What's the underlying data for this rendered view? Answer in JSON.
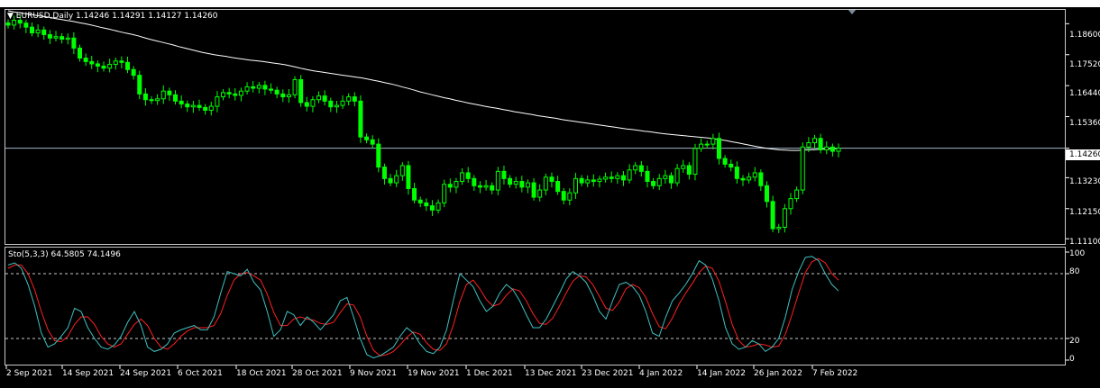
{
  "window": {
    "symbol_header": "EURUSD,Daily  1.14246 1.14291 1.14127 1.14260"
  },
  "indicator": {
    "label": "Sto(5,3,3) 64.5805 74.1496",
    "levels": [
      "100",
      "80",
      "20",
      "0"
    ]
  },
  "price_axis": {
    "labels": [
      "1.18600",
      "1.17520",
      "1.16440",
      "1.15360",
      "1.13230",
      "1.12150",
      "1.11100"
    ],
    "current_price": "1.14260"
  },
  "time_axis": {
    "labels": [
      "2 Sep 2021",
      "14 Sep 2021",
      "24 Sep 2021",
      "6 Oct 2021",
      "18 Oct 2021",
      "28 Oct 2021",
      "9 Nov 2021",
      "19 Nov 2021",
      "1 Dec 2021",
      "13 Dec 2021",
      "23 Dec 2021",
      "4 Jan 2022",
      "14 Jan 2022",
      "26 Jan 2022",
      "7 Feb 2022"
    ]
  },
  "colors": {
    "background": "#000000",
    "candle": "#00ff00",
    "moving_average": "#ffffff",
    "stoch_main": "#40c0c0",
    "stoch_signal": "#ff2020",
    "price_line": "#a0b4c8"
  },
  "chart_data": {
    "type": "line",
    "ylim": [
      1.1095,
      1.1905
    ],
    "candles_close": [
      1.1855,
      1.1872,
      1.1862,
      1.1848,
      1.1828,
      1.1838,
      1.1822,
      1.181,
      1.1815,
      1.1806,
      1.181,
      1.1775,
      1.174,
      1.1728,
      1.172,
      1.1712,
      1.1705,
      1.1718,
      1.173,
      1.1725,
      1.17,
      1.168,
      1.1615,
      1.1595,
      1.1592,
      1.1598,
      1.1625,
      1.1612,
      1.159,
      1.158,
      1.157,
      1.1575,
      1.1568,
      1.1558,
      1.1572,
      1.1605,
      1.162,
      1.1615,
      1.161,
      1.1625,
      1.164,
      1.1635,
      1.1645,
      1.1632,
      1.1628,
      1.1615,
      1.1605,
      1.1612,
      1.1665,
      1.1585,
      1.1572,
      1.1595,
      1.1608,
      1.159,
      1.157,
      1.1575,
      1.159,
      1.1605,
      1.159,
      1.1465,
      1.1455,
      1.144,
      1.136,
      1.132,
      1.1305,
      1.133,
      1.1365,
      1.1285,
      1.1245,
      1.1235,
      1.1225,
      1.121,
      1.1235,
      1.13,
      1.129,
      1.131,
      1.134,
      1.132,
      1.1295,
      1.129,
      1.1295,
      1.128,
      1.1345,
      1.132,
      1.13,
      1.131,
      1.129,
      1.1305,
      1.1255,
      1.128,
      1.1325,
      1.131,
      1.1275,
      1.1245,
      1.127,
      1.132,
      1.1305,
      1.1315,
      1.131,
      1.1318,
      1.1325,
      1.132,
      1.133,
      1.1315,
      1.135,
      1.1365,
      1.1345,
      1.131,
      1.1295,
      1.132,
      1.133,
      1.1305,
      1.1355,
      1.1365,
      1.1335,
      1.1425,
      1.144,
      1.144,
      1.146,
      1.139,
      1.137,
      1.136,
      1.132,
      1.1315,
      1.1325,
      1.134,
      1.1295,
      1.124,
      1.1145,
      1.115,
      1.1215,
      1.125,
      1.128,
      1.143,
      1.1445,
      1.146,
      1.142,
      1.143,
      1.1415,
      1.1426
    ],
    "ma": [
      1.1905,
      1.1901,
      1.1898,
      1.1895,
      1.1892,
      1.1888,
      1.1885,
      1.1882,
      1.1878,
      1.1875,
      1.1871,
      1.1868,
      1.1864,
      1.186,
      1.1856,
      1.1851,
      1.1846,
      1.1842,
      1.1837,
      1.1832,
      1.1827,
      1.1823,
      1.1818,
      1.1812,
      1.1806,
      1.1801,
      1.1796,
      1.1791,
      1.1786,
      1.178,
      1.1775,
      1.177,
      1.1765,
      1.176,
      1.1756,
      1.1752,
      1.1749,
      1.1746,
      1.1742,
      1.1739,
      1.1736,
      1.1733,
      1.1731,
      1.1729,
      1.1726,
      1.1723,
      1.172,
      1.1717,
      1.1713,
      1.1708,
      1.1703,
      1.1699,
      1.1695,
      1.1692,
      1.1689,
      1.1686,
      1.1683,
      1.168,
      1.1677,
      1.1674,
      1.1671,
      1.1667,
      1.1663,
      1.1659,
      1.1654,
      1.165,
      1.1645,
      1.1639,
      1.1634,
      1.1628,
      1.1622,
      1.1617,
      1.1612,
      1.1607,
      1.1602,
      1.1598,
      1.1593,
      1.1589,
      1.1584,
      1.158,
      1.1576,
      1.1572,
      1.1568,
      1.1565,
      1.1561,
      1.1557,
      1.1553,
      1.155,
      1.1546,
      1.1543,
      1.1539,
      1.1536,
      1.1533,
      1.153,
      1.1526,
      1.1523,
      1.152,
      1.1517,
      1.1514,
      1.1511,
      1.1508,
      1.1505,
      1.1502,
      1.1499,
      1.1496,
      1.1493,
      1.1491,
      1.1488,
      1.1485,
      1.1483,
      1.148,
      1.1477,
      1.1475,
      1.1473,
      1.1471,
      1.1469,
      1.1467,
      1.1465,
      1.1463,
      1.1461,
      1.1458,
      1.1455,
      1.1452,
      1.1448,
      1.1444,
      1.144,
      1.1436,
      1.1432,
      1.1428,
      1.1425,
      1.1422,
      1.142,
      1.1419,
      1.1418,
      1.1418,
      1.1419,
      1.142,
      1.1421,
      1.1422,
      1.1423,
      1.1424,
      1.1425
    ],
    "stoch_main": [
      88,
      90,
      85,
      70,
      50,
      25,
      12,
      15,
      22,
      30,
      48,
      45,
      30,
      20,
      12,
      10,
      14,
      22,
      35,
      45,
      32,
      12,
      8,
      10,
      15,
      25,
      28,
      30,
      32,
      28,
      28,
      40,
      62,
      82,
      80,
      78,
      84,
      72,
      65,
      45,
      22,
      28,
      45,
      42,
      32,
      40,
      35,
      28,
      35,
      42,
      55,
      58,
      40,
      20,
      5,
      2,
      4,
      8,
      12,
      22,
      30,
      25,
      15,
      8,
      6,
      12,
      28,
      55,
      80,
      74,
      68,
      55,
      45,
      50,
      62,
      70,
      65,
      55,
      42,
      30,
      30,
      38,
      50,
      62,
      75,
      82,
      78,
      72,
      60,
      45,
      38,
      55,
      70,
      72,
      68,
      60,
      45,
      25,
      22,
      40,
      55,
      62,
      70,
      80,
      92,
      88,
      75,
      55,
      30,
      15,
      10,
      12,
      18,
      15,
      8,
      12,
      20,
      40,
      65,
      82,
      95,
      96,
      92,
      80,
      70,
      64
    ],
    "stoch_signal": [
      85,
      88,
      88,
      80,
      65,
      45,
      28,
      18,
      17,
      22,
      33,
      40,
      40,
      33,
      22,
      15,
      12,
      15,
      24,
      33,
      38,
      32,
      20,
      12,
      10,
      15,
      22,
      27,
      30,
      30,
      30,
      32,
      43,
      60,
      74,
      80,
      81,
      78,
      74,
      61,
      44,
      32,
      32,
      38,
      40,
      38,
      37,
      34,
      33,
      35,
      44,
      52,
      51,
      40,
      22,
      9,
      4,
      5,
      8,
      14,
      21,
      26,
      24,
      16,
      10,
      9,
      15,
      32,
      54,
      70,
      74,
      66,
      56,
      50,
      52,
      60,
      66,
      64,
      55,
      43,
      34,
      33,
      39,
      50,
      62,
      73,
      78,
      77,
      70,
      59,
      48,
      46,
      54,
      66,
      70,
      67,
      58,
      43,
      31,
      29,
      39,
      52,
      62,
      71,
      81,
      87,
      85,
      73,
      54,
      33,
      18,
      12,
      13,
      15,
      14,
      12,
      13,
      24,
      42,
      62,
      81,
      91,
      94,
      90,
      80,
      74
    ]
  }
}
